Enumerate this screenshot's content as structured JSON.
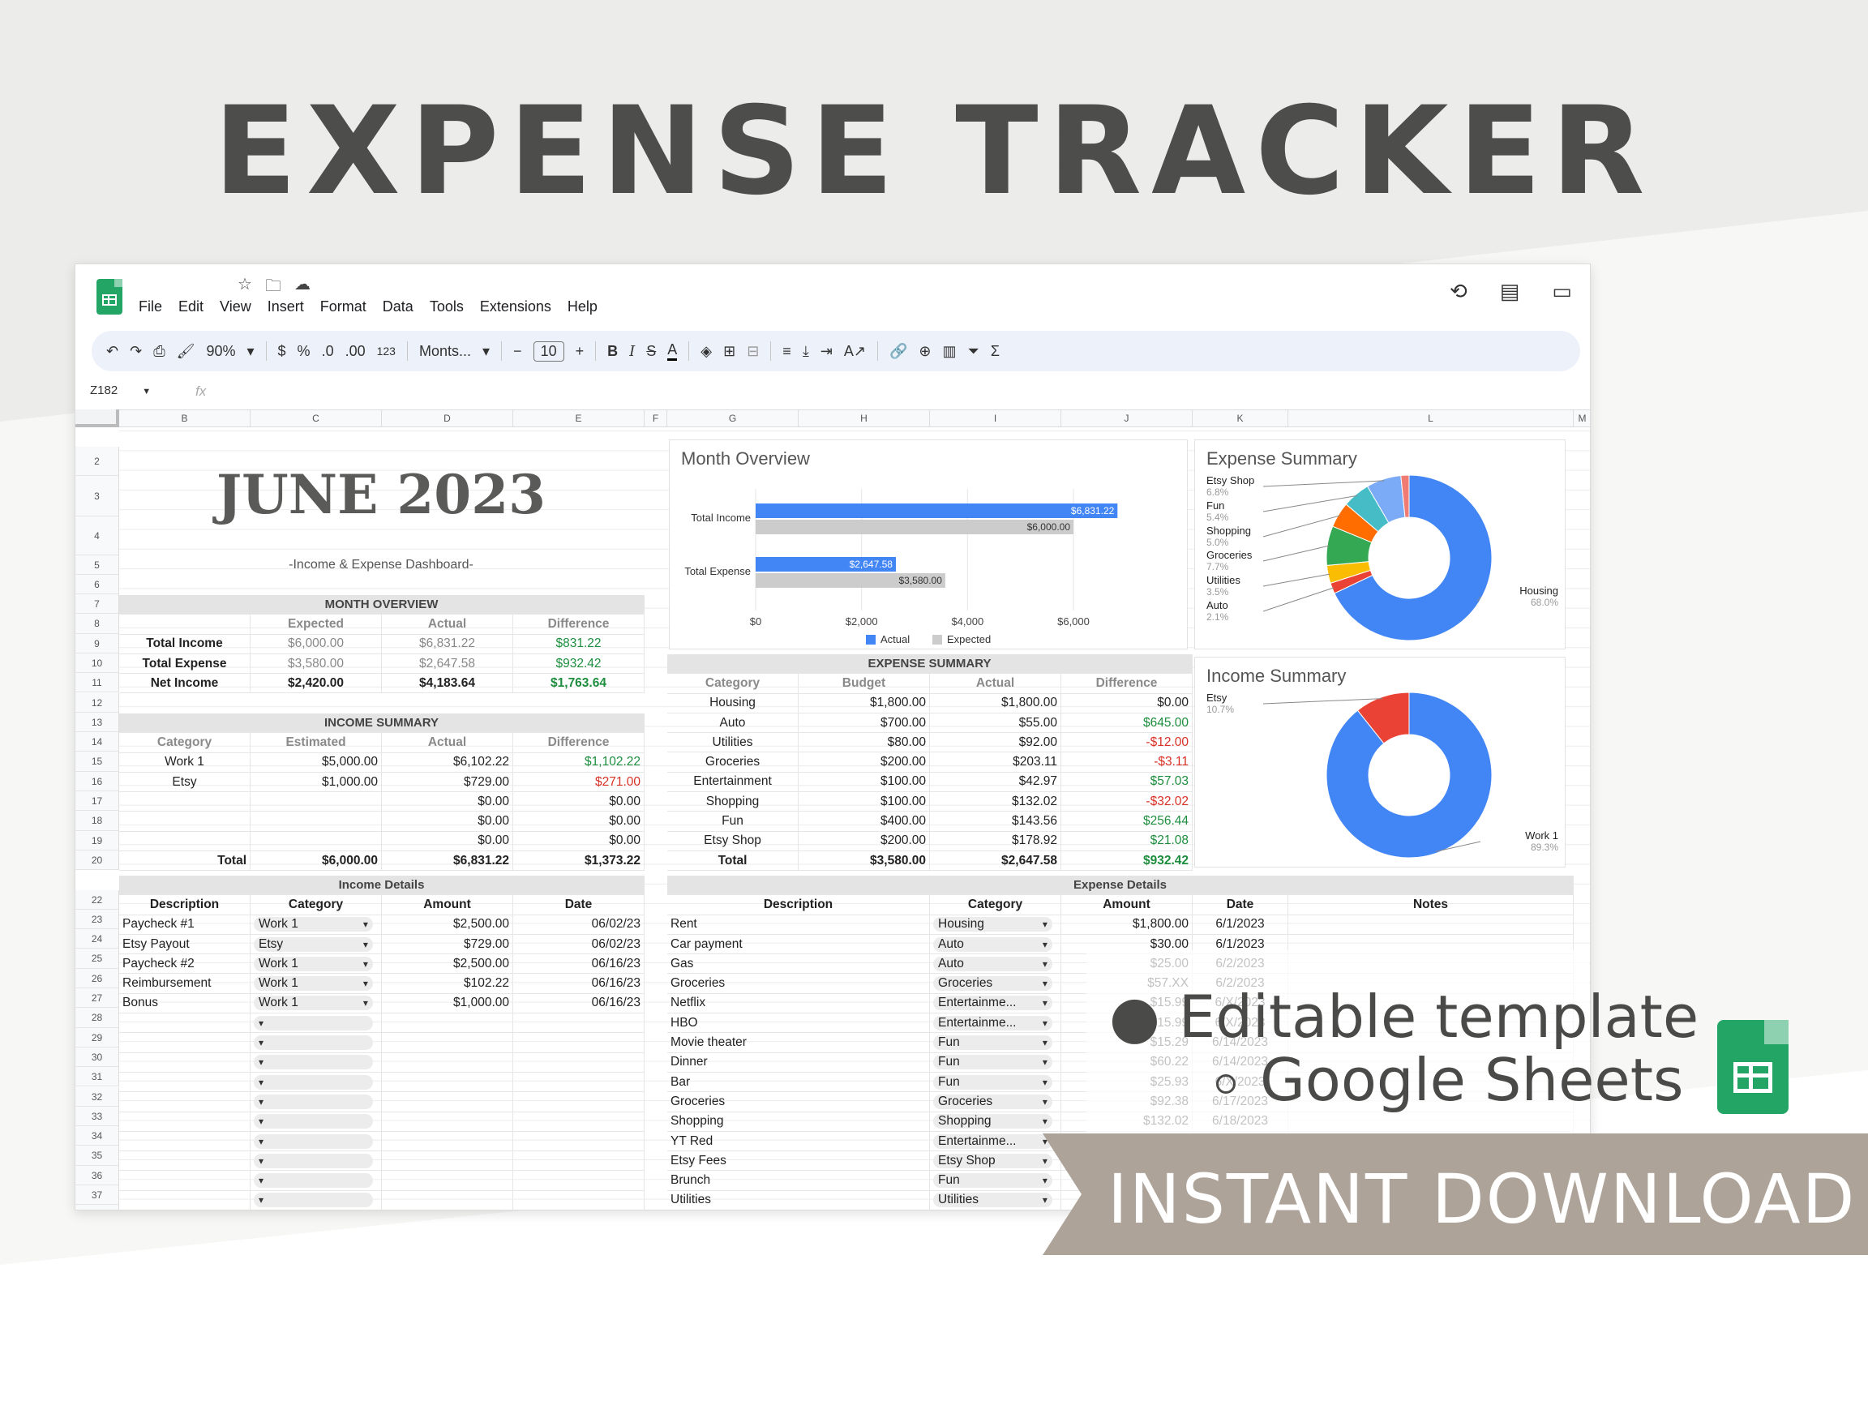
{
  "header": {
    "title": "EXPENSE TRACKER"
  },
  "app": {
    "menu": [
      "File",
      "Edit",
      "View",
      "Insert",
      "Format",
      "Data",
      "Tools",
      "Extensions",
      "Help"
    ],
    "zoom": "90%",
    "currency": "$",
    "percent": "%",
    "dec_less": ".0",
    "dec_more": ".00",
    "num_fmt": "123",
    "font": "Monts...",
    "font_size": "10",
    "cell_ref": "Z182",
    "fx": "fx"
  },
  "columns": [
    "B",
    "C",
    "D",
    "E",
    "F",
    "G",
    "H",
    "I",
    "J",
    "K",
    "L",
    "M"
  ],
  "dashboard": {
    "title": "JUNE 2023",
    "subtitle": "-Income & Expense Dashboard-"
  },
  "month_overview": {
    "title": "MONTH OVERVIEW",
    "headers": [
      "",
      "Expected",
      "Actual",
      "Difference"
    ],
    "rows": [
      [
        "Total Income",
        "$6,000.00",
        "$6,831.22",
        "$831.22"
      ],
      [
        "Total Expense",
        "$3,580.00",
        "$2,647.58",
        "$932.42"
      ],
      [
        "Net Income",
        "$2,420.00",
        "$4,183.64",
        "$1,763.64"
      ]
    ]
  },
  "income_summary": {
    "title": "INCOME SUMMARY",
    "headers": [
      "Category",
      "Estimated",
      "Actual",
      "Difference"
    ],
    "rows": [
      [
        "Work 1",
        "$5,000.00",
        "$6,102.22",
        "$1,102.22"
      ],
      [
        "Etsy",
        "$1,000.00",
        "$729.00",
        "$271.00"
      ],
      [
        "",
        "",
        "$0.00",
        "$0.00"
      ],
      [
        "",
        "",
        "$0.00",
        "$0.00"
      ],
      [
        "",
        "",
        "$0.00",
        "$0.00"
      ]
    ],
    "total": [
      "Total",
      "$6,000.00",
      "$6,831.22",
      "$1,373.22"
    ]
  },
  "expense_summary": {
    "title": "EXPENSE SUMMARY",
    "headers": [
      "Category",
      "Budget",
      "Actual",
      "Difference"
    ],
    "rows": [
      [
        "Housing",
        "$1,800.00",
        "$1,800.00",
        "$0.00"
      ],
      [
        "Auto",
        "$700.00",
        "$55.00",
        "$645.00"
      ],
      [
        "Utilities",
        "$80.00",
        "$92.00",
        "-$12.00"
      ],
      [
        "Groceries",
        "$200.00",
        "$203.11",
        "-$3.11"
      ],
      [
        "Entertainment",
        "$100.00",
        "$42.97",
        "$57.03"
      ],
      [
        "Shopping",
        "$100.00",
        "$132.02",
        "-$32.02"
      ],
      [
        "Fun",
        "$400.00",
        "$143.56",
        "$256.44"
      ],
      [
        "Etsy Shop",
        "$200.00",
        "$178.92",
        "$21.08"
      ]
    ],
    "total": [
      "Total",
      "$3,580.00",
      "$2,647.58",
      "$932.42"
    ]
  },
  "income_details": {
    "title": "Income Details",
    "headers": [
      "Description",
      "Category",
      "Amount",
      "Date"
    ],
    "rows": [
      [
        "Paycheck #1",
        "Work 1",
        "$2,500.00",
        "06/02/23"
      ],
      [
        "Etsy Payout",
        "Etsy",
        "$729.00",
        "06/02/23"
      ],
      [
        "Paycheck #2",
        "Work 1",
        "$2,500.00",
        "06/16/23"
      ],
      [
        "Reimbursement",
        "Work 1",
        "$102.22",
        "06/16/23"
      ],
      [
        "Bonus",
        "Work 1",
        "$1,000.00",
        "06/16/23"
      ]
    ]
  },
  "expense_details": {
    "title": "Expense Details",
    "headers": [
      "Description",
      "Category",
      "Amount",
      "Date",
      "Notes"
    ],
    "rows": [
      [
        "Rent",
        "Housing",
        "$1,800.00",
        "6/1/2023"
      ],
      [
        "Car payment",
        "Auto",
        "$30.00",
        "6/1/2023"
      ],
      [
        "Gas",
        "Auto",
        "$25.00",
        "6/2/2023"
      ],
      [
        "Groceries",
        "Groceries",
        "$57.XX",
        "6/2/2023"
      ],
      [
        "Netflix",
        "Entertainme...",
        "$15.99",
        "6/X/2023"
      ],
      [
        "HBO",
        "Entertainme...",
        "$15.99",
        "6/X/2023"
      ],
      [
        "Movie theater",
        "Fun",
        "$15.29",
        "6/14/2023"
      ],
      [
        "Dinner",
        "Fun",
        "$60.22",
        "6/14/2023"
      ],
      [
        "Bar",
        "Fun",
        "$25.93",
        "6/X/2023"
      ],
      [
        "Groceries",
        "Groceries",
        "$92.38",
        "6/17/2023"
      ],
      [
        "Shopping",
        "Shopping",
        "$132.02",
        "6/18/2023"
      ],
      [
        "YT Red",
        "Entertainme...",
        "",
        " "
      ],
      [
        "Etsy Fees",
        "Etsy Shop",
        "",
        ""
      ],
      [
        "Brunch",
        "Fun",
        "",
        ""
      ],
      [
        "Utilities",
        "Utilities",
        "",
        ""
      ]
    ]
  },
  "chart_data": [
    {
      "type": "bar",
      "title": "Month Overview",
      "categories": [
        "Total Income",
        "Total Expense"
      ],
      "series": [
        {
          "name": "Actual",
          "values": [
            6831.22,
            2647.58
          ],
          "labels": [
            "$6,831.22",
            "$2,647.58"
          ],
          "color": "#4285f4"
        },
        {
          "name": "Expected",
          "values": [
            6000,
            3580
          ],
          "labels": [
            "$6,000.00",
            "$3,580.00"
          ],
          "color": "#cccccc"
        }
      ],
      "xlim": [
        0,
        7500
      ],
      "ticks": [
        "$0",
        "$2,000",
        "$4,000",
        "$6,000"
      ],
      "tick_values": [
        0,
        2000,
        4000,
        6000
      ],
      "legend": "bottom"
    },
    {
      "type": "pie",
      "title": "Expense Summary",
      "slices": [
        {
          "label": "Housing",
          "pct": "68.0%",
          "value": 68.0,
          "color": "#4285f4"
        },
        {
          "label": "Auto",
          "pct": "2.1%",
          "value": 2.1,
          "color": "#ea4335"
        },
        {
          "label": "Utilities",
          "pct": "3.5%",
          "value": 3.5,
          "color": "#fbbc04"
        },
        {
          "label": "Groceries",
          "pct": "7.7%",
          "value": 7.7,
          "color": "#34a853"
        },
        {
          "label": "Shopping",
          "pct": "5.0%",
          "value": 5.0,
          "color": "#ff6d01"
        },
        {
          "label": "Fun",
          "pct": "5.4%",
          "value": 5.4,
          "color": "#46bdc6"
        },
        {
          "label": "Etsy Shop",
          "pct": "6.8%",
          "value": 6.8,
          "color": "#7baaf7"
        },
        {
          "label": "",
          "pct": "",
          "value": 1.6,
          "color": "#f07b72"
        }
      ]
    },
    {
      "type": "pie",
      "title": "Income Summary",
      "slices": [
        {
          "label": "Work 1",
          "pct": "89.3%",
          "value": 89.3,
          "color": "#4285f4"
        },
        {
          "label": "Etsy",
          "pct": "10.7%",
          "value": 10.7,
          "color": "#ea4335"
        }
      ]
    }
  ],
  "promo": {
    "bullet1": "Editable template",
    "bullet2": "Google Sheets",
    "banner": "INSTANT DOWNLOAD"
  }
}
